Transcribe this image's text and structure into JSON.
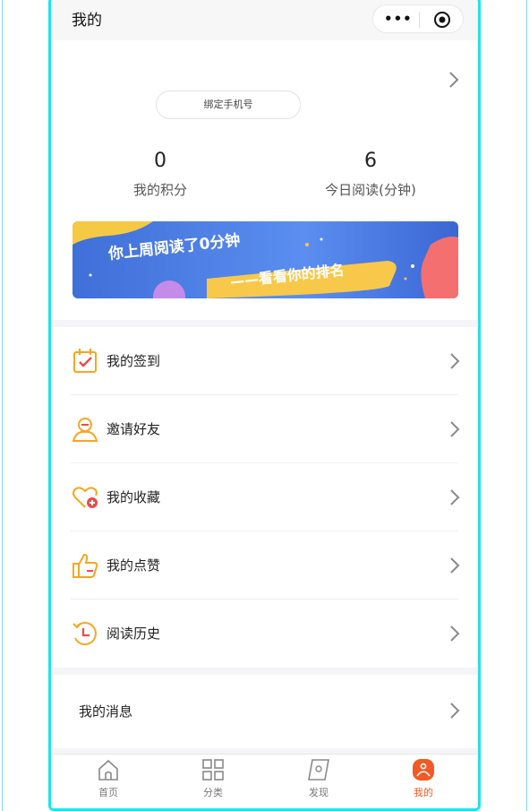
{
  "header": {
    "title": "我的"
  },
  "profile": {
    "bind_phone_label": "绑定手机号"
  },
  "stats": [
    {
      "value": "0",
      "label": "我的积分"
    },
    {
      "value": "6",
      "label": "今日阅读(分钟)"
    }
  ],
  "banner": {
    "line1": "你上周阅读了0分钟",
    "line2": "——看看你的排名"
  },
  "menu": [
    {
      "label": "我的签到",
      "icon": "calendar-check-icon"
    },
    {
      "label": "邀请好友",
      "icon": "person-icon"
    },
    {
      "label": "我的收藏",
      "icon": "heart-plus-icon"
    },
    {
      "label": "我的点赞",
      "icon": "thumbs-up-icon"
    },
    {
      "label": "阅读历史",
      "icon": "clock-history-icon"
    }
  ],
  "messages": {
    "label": "我的消息"
  },
  "tabbar": [
    {
      "label": "首页",
      "icon": "home-icon"
    },
    {
      "label": "分类",
      "icon": "grid-icon"
    },
    {
      "label": "发现",
      "icon": "discover-icon"
    },
    {
      "label": "我的",
      "icon": "profile-icon",
      "active": true
    }
  ],
  "colors": {
    "accent": "#f15a24",
    "icon_orange": "#f5a623",
    "frame": "#1de4ea"
  }
}
